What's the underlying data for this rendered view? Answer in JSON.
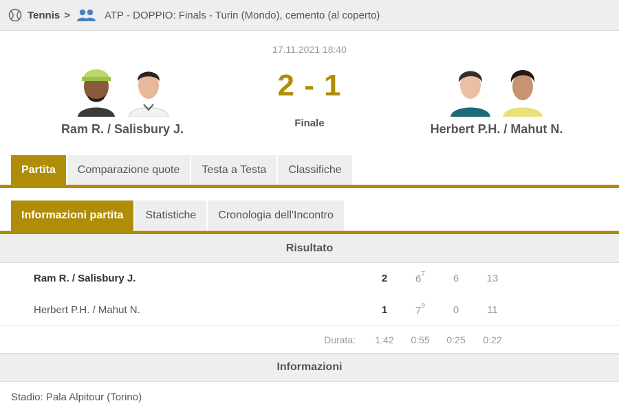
{
  "breadcrumb": {
    "sport": "Tennis",
    "separator": ">",
    "tournament": "ATP - DOPPIO: Finals - Turin (Mondo), cemento (al coperto)",
    "sport_icon": "tennis-ball-icon",
    "category_icon": "doubles-players-icon"
  },
  "match": {
    "datetime": "17.11.2021 18:40",
    "score": "2 - 1",
    "status": "Finale",
    "home_team": "Ram R. / Salisbury J.",
    "away_team": "Herbert P.H. / Mahut N."
  },
  "tabs_main": [
    "Partita",
    "Comparazione quote",
    "Testa a Testa",
    "Classifiche"
  ],
  "tabs_sub": [
    "Informazioni partita",
    "Statistiche",
    "Cronologia dell'Incontro"
  ],
  "result": {
    "heading": "Risultato",
    "rows": [
      {
        "name": "Ram R. / Salisbury J.",
        "total": "2",
        "s1": "6",
        "s1_tb": "7",
        "s2": "6",
        "s3": "13"
      },
      {
        "name": "Herbert P.H. / Mahut N.",
        "total": "1",
        "s1": "7",
        "s1_tb": "9",
        "s2": "0",
        "s3": "11"
      }
    ],
    "duration_label": "Durata:",
    "durations": [
      "1:42",
      "0:55",
      "0:25",
      "0:22"
    ]
  },
  "info": {
    "heading": "Informazioni",
    "stadium": "Stadio: Pala Alpitour (Torino)"
  },
  "colors": {
    "accent": "#b08d08",
    "tab_bg": "#eeeeee"
  }
}
